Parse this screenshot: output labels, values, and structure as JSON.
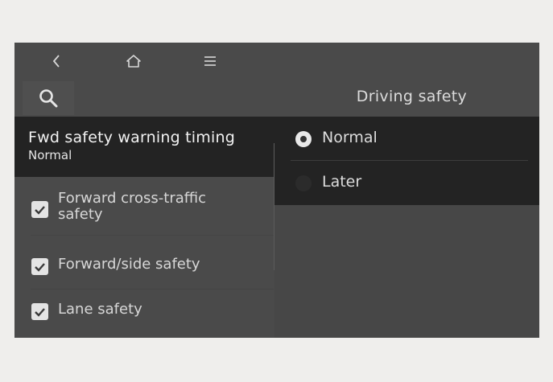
{
  "header": {
    "title": "Driving safety"
  },
  "nav": {
    "back_icon": "chevron-left-icon",
    "home_icon": "home-icon",
    "menu_icon": "menu-icon",
    "search_icon": "search-icon"
  },
  "sidebar": {
    "selected": {
      "title": "Fwd safety warning timing",
      "value": "Normal"
    },
    "items": [
      {
        "label": "Forward cross-traffic safety",
        "checked": true
      },
      {
        "label": "Forward/side safety",
        "checked": true
      },
      {
        "label": "Lane safety",
        "checked": true
      }
    ]
  },
  "options": {
    "items": [
      {
        "label": "Normal",
        "selected": true
      },
      {
        "label": "Later",
        "selected": false
      }
    ]
  },
  "colors": {
    "screen_bg": "#4a4a4a",
    "selected_bg": "#232323",
    "page_bg": "#efeeec"
  }
}
